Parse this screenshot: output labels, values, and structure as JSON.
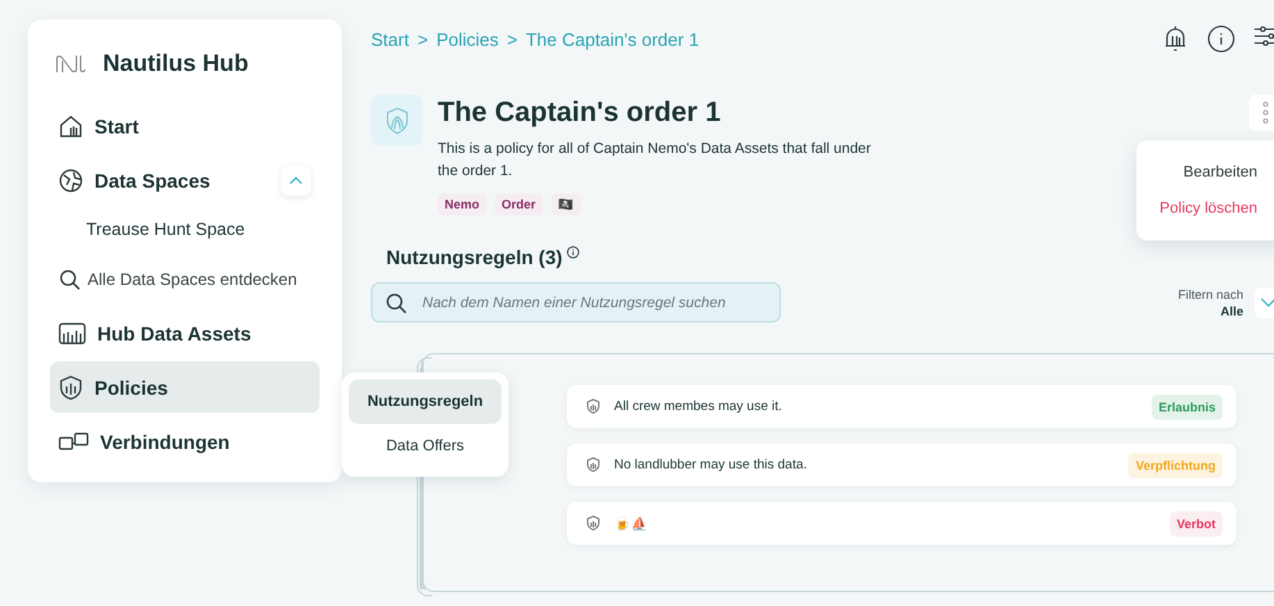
{
  "app": {
    "name": "Nautilus Hub"
  },
  "sidebar": {
    "items": [
      {
        "label": "Start",
        "kind": "main",
        "selected": false
      },
      {
        "label": "Data Spaces",
        "kind": "main",
        "selected": false,
        "expanded": true
      },
      {
        "label": "Treause Hunt Space",
        "kind": "sub",
        "selected": false
      },
      {
        "label": "Alle Data Spaces entdecken",
        "kind": "link",
        "selected": false
      },
      {
        "label": "Hub Data Assets",
        "kind": "main",
        "selected": false
      },
      {
        "label": "Policies",
        "kind": "main",
        "selected": true
      },
      {
        "label": "Verbindungen",
        "kind": "main",
        "selected": false
      }
    ]
  },
  "breadcrumb": [
    "Start",
    "Policies",
    "The Captain's order 1"
  ],
  "breadcrumb_separator": ">",
  "policy": {
    "title": "The Captain's order 1",
    "description": "This is a policy for all of Captain Nemo's Data Assets that fall under the order  1.",
    "tags": [
      "Nemo",
      "Order",
      "🏴‍☠️"
    ]
  },
  "menu": {
    "items": [
      {
        "label": "Bearbeiten",
        "kind": "normal"
      },
      {
        "label": "Policy löschen",
        "kind": "danger"
      }
    ]
  },
  "rules_heading": "Nutzungsregeln (3)",
  "search": {
    "placeholder": "Nach dem Namen einer Nutzungsregel suchen"
  },
  "filter": {
    "label": "Filtern nach",
    "value": "Alle"
  },
  "tabs": [
    {
      "label": "Nutzungsregeln",
      "selected": true
    },
    {
      "label": "Data Offers",
      "selected": false
    }
  ],
  "rules": [
    {
      "text": "All crew membes may use it.",
      "kind": "permission",
      "badge": "Erlaubnis"
    },
    {
      "text": "No landlubber may use this data.",
      "kind": "obligation",
      "badge": "Verpflichtung"
    },
    {
      "text": "🍺⛵",
      "kind": "prohibition",
      "badge": "Verbot"
    }
  ]
}
